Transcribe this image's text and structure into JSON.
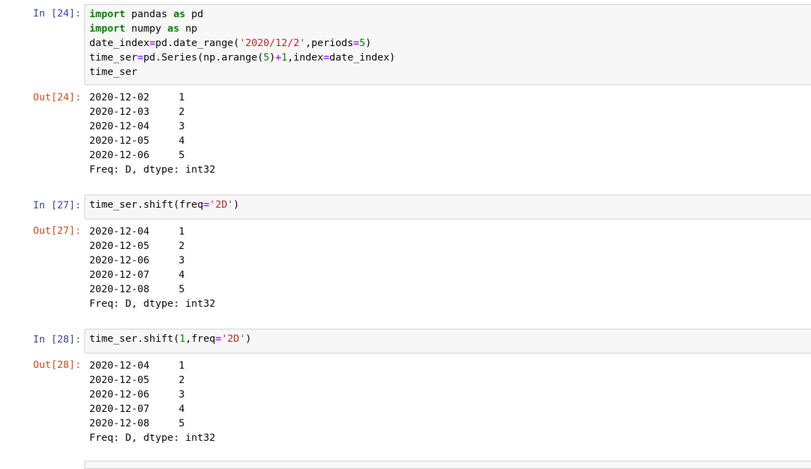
{
  "cells": [
    {
      "in_prompt": "In [24]:",
      "code": [
        [
          [
            "kw",
            "import"
          ],
          [
            "t",
            " pandas "
          ],
          [
            "kw",
            "as"
          ],
          [
            "t",
            " pd"
          ]
        ],
        [
          [
            "kw",
            "import"
          ],
          [
            "t",
            " numpy "
          ],
          [
            "kw",
            "as"
          ],
          [
            "t",
            " np"
          ]
        ],
        [
          [
            "t",
            "date_index"
          ],
          [
            "op",
            "="
          ],
          [
            "t",
            "pd.date_range("
          ],
          [
            "str",
            "'2020/12/2'"
          ],
          [
            "t",
            ",periods"
          ],
          [
            "op",
            "="
          ],
          [
            "num",
            "5"
          ],
          [
            "t",
            ")"
          ]
        ],
        [
          [
            "t",
            "time_ser"
          ],
          [
            "op",
            "="
          ],
          [
            "t",
            "pd.Series(np.arange("
          ],
          [
            "num",
            "5"
          ],
          [
            "t",
            ")"
          ],
          [
            "op",
            "+"
          ],
          [
            "num",
            "1"
          ],
          [
            "t",
            ",index"
          ],
          [
            "op",
            "="
          ],
          [
            "t",
            "date_index)"
          ]
        ],
        [
          [
            "t",
            "time_ser"
          ]
        ]
      ],
      "out_prompt": "Out[24]:",
      "output": {
        "rows": [
          {
            "index": "2020-12-02",
            "value": "1"
          },
          {
            "index": "2020-12-03",
            "value": "2"
          },
          {
            "index": "2020-12-04",
            "value": "3"
          },
          {
            "index": "2020-12-05",
            "value": "4"
          },
          {
            "index": "2020-12-06",
            "value": "5"
          }
        ],
        "footer": "Freq: D, dtype: int32"
      }
    },
    {
      "in_prompt": "In [27]:",
      "code": [
        [
          [
            "t",
            "time_ser.shift(freq"
          ],
          [
            "op",
            "="
          ],
          [
            "str",
            "'2D'"
          ],
          [
            "t",
            ")"
          ]
        ]
      ],
      "out_prompt": "Out[27]:",
      "output": {
        "rows": [
          {
            "index": "2020-12-04",
            "value": "1"
          },
          {
            "index": "2020-12-05",
            "value": "2"
          },
          {
            "index": "2020-12-06",
            "value": "3"
          },
          {
            "index": "2020-12-07",
            "value": "4"
          },
          {
            "index": "2020-12-08",
            "value": "5"
          }
        ],
        "footer": "Freq: D, dtype: int32"
      }
    },
    {
      "in_prompt": "In [28]:",
      "code": [
        [
          [
            "t",
            "time_ser.shift("
          ],
          [
            "num",
            "1"
          ],
          [
            "t",
            ",freq"
          ],
          [
            "op",
            "="
          ],
          [
            "str",
            "'2D'"
          ],
          [
            "t",
            ")"
          ]
        ]
      ],
      "out_prompt": "Out[28]:",
      "output": {
        "rows": [
          {
            "index": "2020-12-04",
            "value": "1"
          },
          {
            "index": "2020-12-05",
            "value": "2"
          },
          {
            "index": "2020-12-06",
            "value": "3"
          },
          {
            "index": "2020-12-07",
            "value": "4"
          },
          {
            "index": "2020-12-08",
            "value": "5"
          }
        ],
        "footer": "Freq: D, dtype: int32"
      }
    }
  ]
}
